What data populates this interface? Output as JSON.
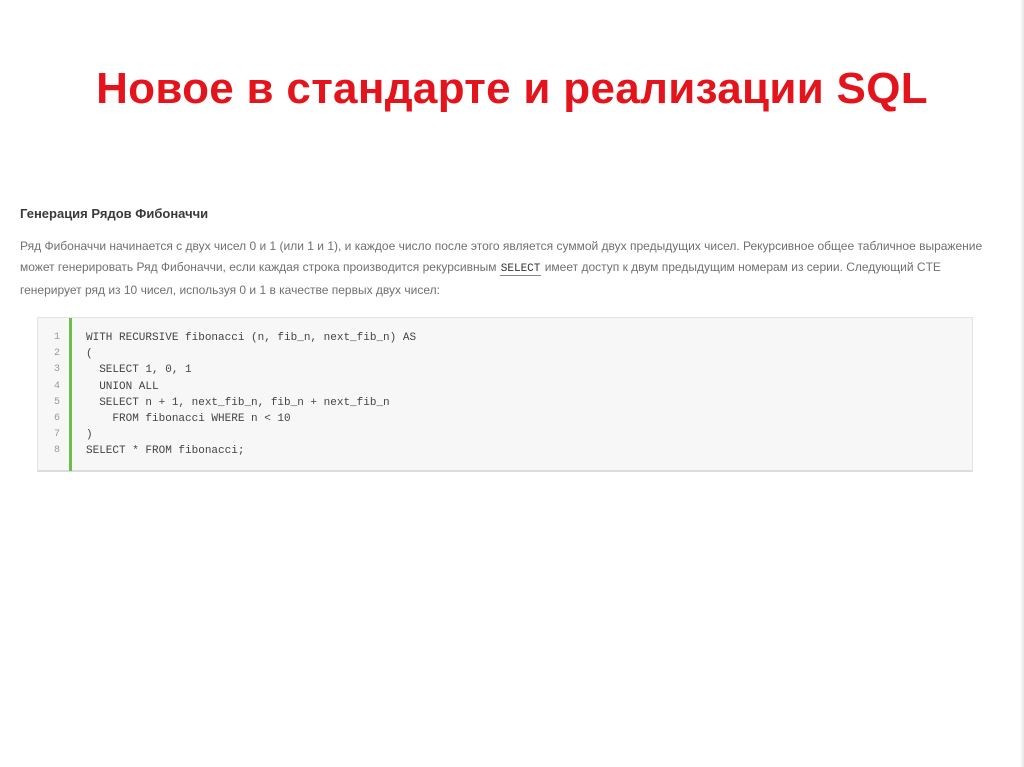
{
  "slide": {
    "title": "Новое в стандарте и реализации SQL",
    "title_color": "#e3141b"
  },
  "article": {
    "heading": "Генерация Рядов Фибоначчи",
    "paragraph_part1": "Ряд Фибоначчи начинается с двух чисел 0 и 1 (или 1 и 1), и каждое число после этого является суммой двух предыдущих чисел. Рекурсивное общее табличное выражение может генерировать Ряд Фибоначчи, если каждая строка производится рекурсивным ",
    "inline_code": "SELECT",
    "paragraph_part2": " имеет доступ к двум предыдущим номерам из серии. Следующий CTE генерирует ряд из 10 чисел, используя 0 и 1 в качестве первых двух чисел:"
  },
  "code_block": {
    "accent_color": "#6cc04a",
    "line_numbers": [
      "1",
      "2",
      "3",
      "4",
      "5",
      "6",
      "7",
      "8"
    ],
    "lines": [
      "WITH RECURSIVE fibonacci (n, fib_n, next_fib_n) AS",
      "(",
      "  SELECT 1, 0, 1",
      "  UNION ALL",
      "  SELECT n + 1, next_fib_n, fib_n + next_fib_n",
      "    FROM fibonacci WHERE n < 10",
      ")",
      "SELECT * FROM fibonacci;"
    ]
  }
}
